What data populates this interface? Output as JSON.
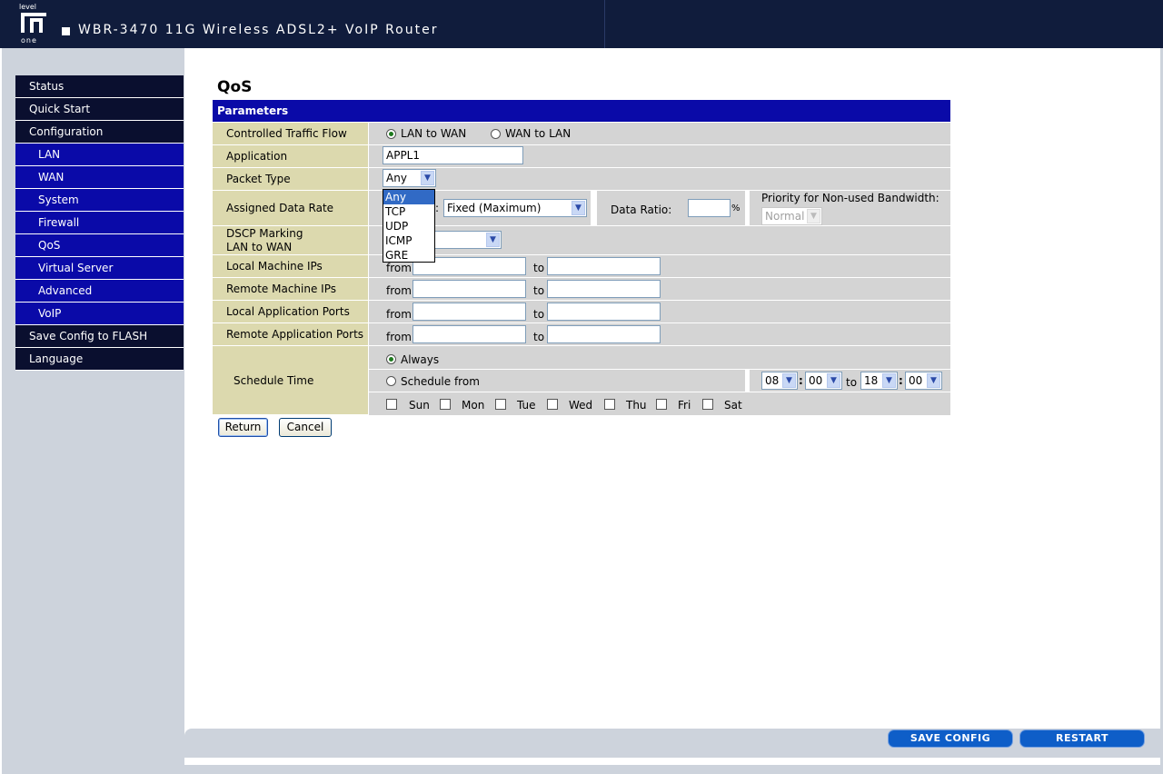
{
  "header": {
    "logo_text": [
      "level",
      "one"
    ],
    "title": "WBR-3470 11G Wireless ADSL2+ VoIP Router"
  },
  "sidebar": {
    "items": [
      {
        "label": "Status",
        "level": "top"
      },
      {
        "label": "Quick Start",
        "level": "top"
      },
      {
        "label": "Configuration",
        "level": "top"
      },
      {
        "label": "LAN",
        "level": "sub"
      },
      {
        "label": "WAN",
        "level": "sub"
      },
      {
        "label": "System",
        "level": "sub"
      },
      {
        "label": "Firewall",
        "level": "sub"
      },
      {
        "label": "QoS",
        "level": "sub"
      },
      {
        "label": "Virtual Server",
        "level": "sub"
      },
      {
        "label": "Advanced",
        "level": "sub"
      },
      {
        "label": "VoIP",
        "level": "sub"
      },
      {
        "label": "Save Config to FLASH",
        "level": "top"
      },
      {
        "label": "Language",
        "level": "top"
      }
    ]
  },
  "page": {
    "title": "QoS",
    "section_header": "Parameters"
  },
  "form": {
    "traffic_flow": {
      "label": "Controlled Traffic Flow",
      "opt_lan_to_wan": "LAN to WAN",
      "opt_wan_to_lan": "WAN to LAN",
      "selected": "LAN to WAN"
    },
    "application": {
      "label": "Application",
      "value": "APPL1"
    },
    "packet_type": {
      "label": "Packet Type",
      "value": "Any",
      "options": [
        "Any",
        "TCP",
        "UDP",
        "ICMP",
        "GRE"
      ]
    },
    "data_rate": {
      "label": "Assigned Data Rate",
      "hidden_prefix": ":",
      "rate_value": "Fixed (Maximum)",
      "ratio_label": "Data Ratio:",
      "ratio_value": "",
      "ratio_unit": "%",
      "priority_label": "Priority for Non-used Bandwidth:",
      "priority_value": "Normal"
    },
    "dscp": {
      "label_line1": "DSCP Marking",
      "label_line2": "LAN to WAN",
      "value": ""
    },
    "local_ips": {
      "label": "Local Machine IPs",
      "from_label": "from",
      "to_label": "to",
      "from_value": "",
      "to_value": ""
    },
    "remote_ips": {
      "label": "Remote Machine IPs",
      "from_label": "from",
      "to_label": "to",
      "from_value": "",
      "to_value": ""
    },
    "local_ports": {
      "label": "Local Application Ports",
      "from_label": "from",
      "to_label": "to",
      "from_value": "",
      "to_value": ""
    },
    "remote_ports": {
      "label": "Remote Application Ports",
      "from_label": "from",
      "to_label": "to",
      "from_value": "",
      "to_value": ""
    },
    "schedule": {
      "label": "Schedule Time",
      "opt_always": "Always",
      "opt_schedule": "Schedule from",
      "selected": "Always",
      "start_hour": "08",
      "start_min": "00",
      "to_label": "to",
      "colon": ":",
      "end_hour": "18",
      "end_min": "00",
      "days": [
        "Sun",
        "Mon",
        "Tue",
        "Wed",
        "Thu",
        "Fri",
        "Sat"
      ]
    }
  },
  "buttons": {
    "return": "Return",
    "cancel": "Cancel",
    "save_config": "SAVE CONFIG",
    "restart": "RESTART"
  },
  "colors": {
    "header_bg": "#101c3c",
    "nav_top": "#0a0f2f",
    "nav_sub": "#0a0aa8",
    "label_bg": "#dcd9ae",
    "value_bg": "#d4d4d4",
    "section_header": "#0a0aa8",
    "bottom_button": "#0e5ec8"
  }
}
